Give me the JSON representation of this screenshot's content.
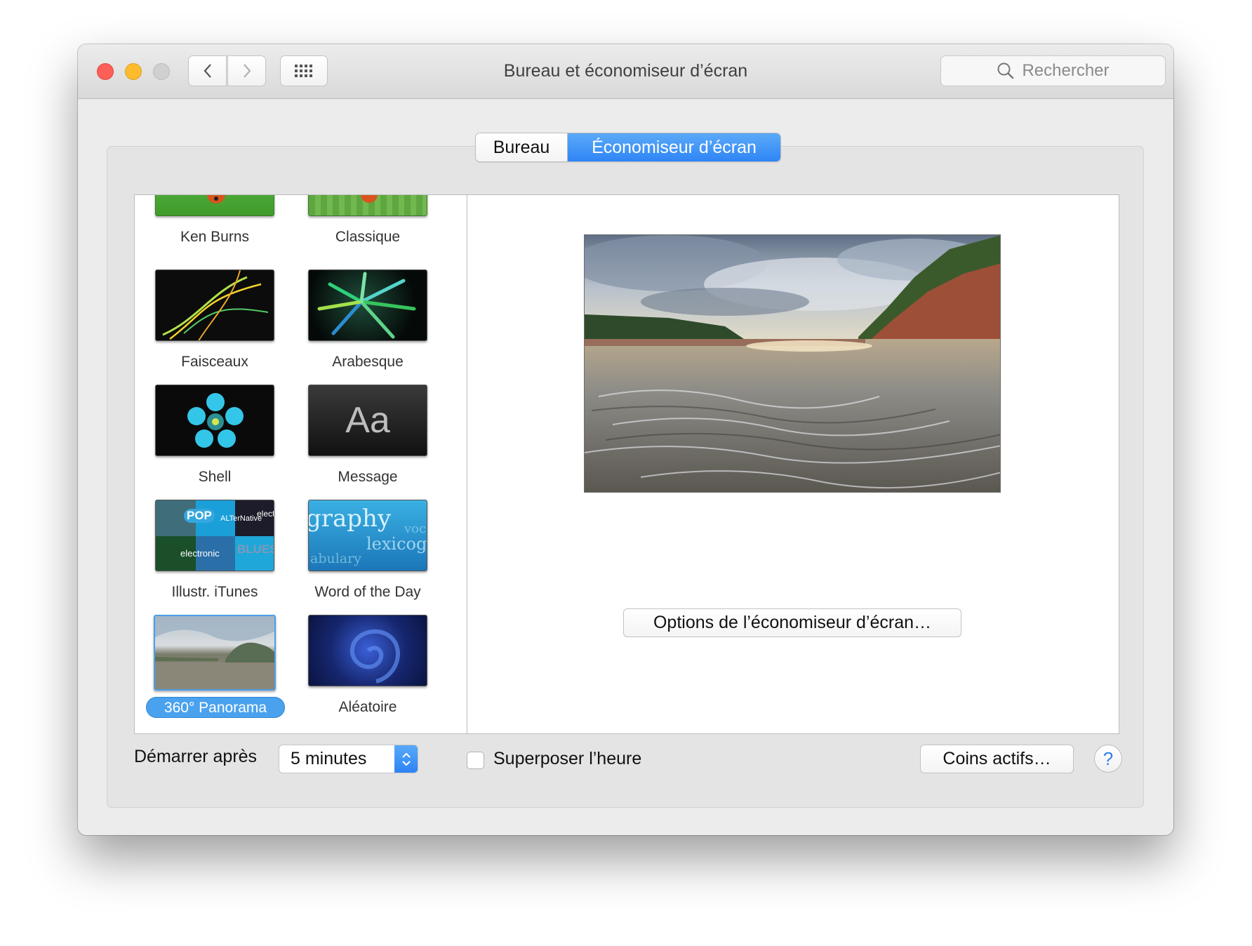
{
  "window": {
    "title": "Bureau et économiseur d’écran",
    "search_placeholder": "Rechercher"
  },
  "tabs": [
    {
      "label": "Bureau",
      "selected": false
    },
    {
      "label": "Économiseur d’écran",
      "selected": true
    }
  ],
  "screensavers": [
    {
      "label": "Ken Burns"
    },
    {
      "label": "Classique"
    },
    {
      "label": "Faisceaux"
    },
    {
      "label": "Arabesque"
    },
    {
      "label": "Shell"
    },
    {
      "label": "Message",
      "thumb_text": "Aa"
    },
    {
      "label": "Illustr. iTunes",
      "thumb_words": [
        "POP",
        "ALTerNative",
        "electronic",
        "BLUES",
        "electr"
      ]
    },
    {
      "label": "Word of the Day",
      "thumb_words": [
        "graphy",
        "lexicog",
        "abulary",
        "voc"
      ]
    },
    {
      "label": "360° Panorama",
      "selected": true
    },
    {
      "label": "Aléatoire"
    }
  ],
  "preview": {
    "options_button": "Options de l’économiseur d’écran…"
  },
  "footer": {
    "start_after_label": "Démarrer après",
    "start_after_value": "5 minutes",
    "show_clock_label": "Superposer l’heure",
    "show_clock_checked": false,
    "hot_corners_button": "Coins actifs…",
    "help_symbol": "?"
  },
  "colors": {
    "accent": "#3a8ff6",
    "selected_label": "#4aa2ee",
    "close": "#fc5f57",
    "minimize": "#fdbc2e"
  }
}
